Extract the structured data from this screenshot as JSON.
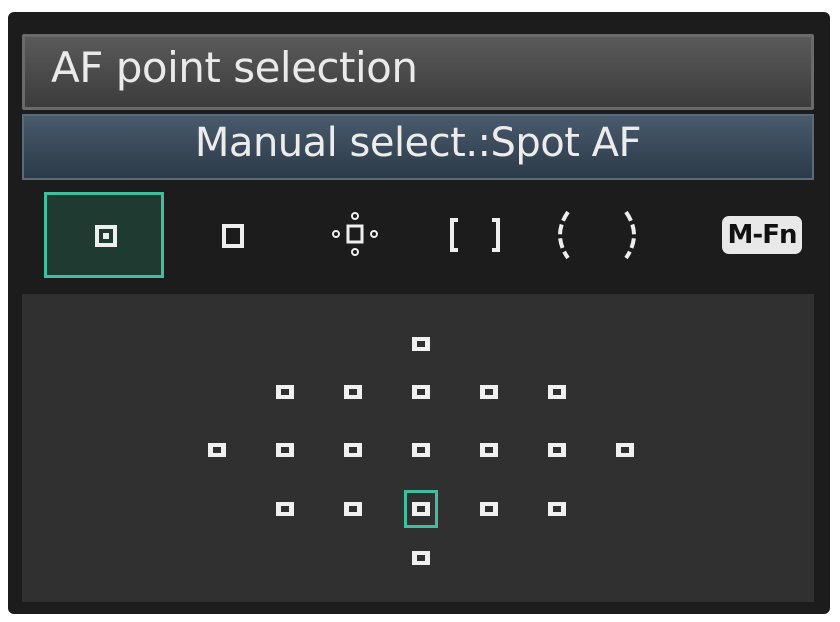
{
  "header": {
    "title": "AF point selection"
  },
  "mode": {
    "label": "Manual select.:Spot AF"
  },
  "area_modes": [
    {
      "name": "spot-af",
      "selected": true
    },
    {
      "name": "single-point-af",
      "selected": false
    },
    {
      "name": "af-point-expansion",
      "selected": false
    },
    {
      "name": "zone-af",
      "selected": false
    },
    {
      "name": "auto-select-af",
      "selected": false
    }
  ],
  "mfn": {
    "label": "M-Fn"
  },
  "af_points": {
    "columns": [
      -3,
      -2,
      -1,
      0,
      1,
      2,
      3
    ],
    "rows": [
      [
        0
      ],
      [
        -2,
        -1,
        0,
        1,
        2
      ],
      [
        -3,
        -2,
        -1,
        0,
        1,
        2,
        3
      ],
      [
        -2,
        -1,
        0,
        1,
        2
      ],
      [
        0
      ]
    ],
    "selected": {
      "row": 3,
      "col": 0
    }
  },
  "colors": {
    "accent": "#3fbfa0",
    "background": "#1c1c1c"
  }
}
